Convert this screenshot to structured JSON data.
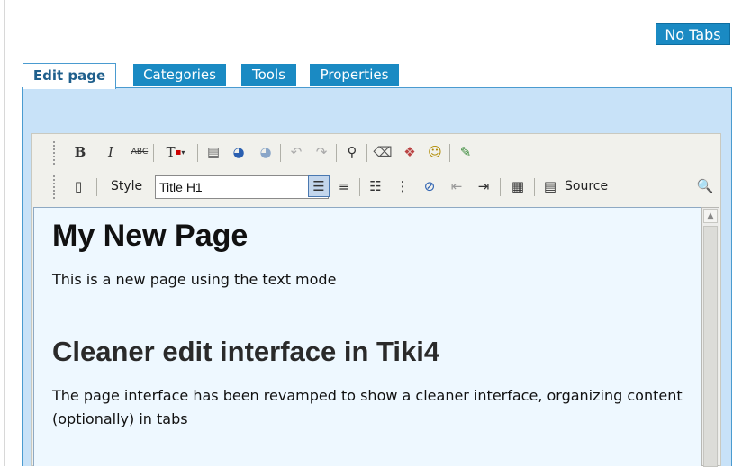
{
  "page": {
    "heading_fragment": "w Page"
  },
  "toggle": {
    "no_tabs_label": "No Tabs"
  },
  "tabs": [
    {
      "label": "Edit page",
      "active": true
    },
    {
      "label": "Categories",
      "active": false
    },
    {
      "label": "Tools",
      "active": false
    },
    {
      "label": "Properties",
      "active": false
    }
  ],
  "toolbar": {
    "row1": [
      {
        "icon": "bold-icon",
        "glyph": "B"
      },
      {
        "icon": "italic-icon",
        "glyph": "I"
      },
      {
        "icon": "strikethrough-icon",
        "glyph": "ABC"
      },
      {
        "icon": "text-color-icon",
        "glyph": "T"
      },
      {
        "icon": "paste-text-icon",
        "glyph": "📋"
      },
      {
        "icon": "insert-link-icon",
        "glyph": "🌐"
      },
      {
        "icon": "remove-link-icon",
        "glyph": "🌐"
      },
      {
        "icon": "undo-icon",
        "glyph": "↶"
      },
      {
        "icon": "redo-icon",
        "glyph": "↷"
      },
      {
        "icon": "find-icon",
        "glyph": "🔭"
      },
      {
        "icon": "eraser-icon",
        "glyph": "⌫"
      },
      {
        "icon": "3d-box-icon",
        "glyph": "🎲"
      },
      {
        "icon": "smiley-icon",
        "glyph": "☺"
      },
      {
        "icon": "wiki-plugin-icon",
        "glyph": "✎"
      }
    ],
    "style_label": "Style",
    "style_value": "Title H1",
    "source_label": "Source"
  },
  "content": {
    "h1": "My New Page",
    "p1": "This is a new page using the text mode",
    "h2": "Cleaner edit interface in Tiki4",
    "p2": "The page interface has been revamped to show a cleaner interface, organizing content (optionally) in tabs"
  }
}
